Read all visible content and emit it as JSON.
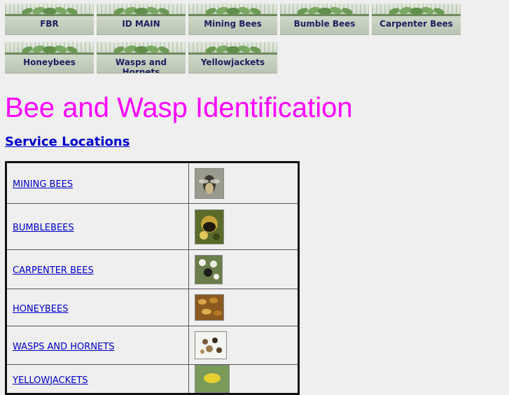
{
  "nav": {
    "row1": [
      "FBR",
      "ID MAIN",
      "Mining Bees",
      "Bumble Bees",
      "Carpenter Bees"
    ],
    "row2": [
      "Honeybees",
      "Wasps and Hornets",
      "Yellowjackets"
    ]
  },
  "page": {
    "title": "Bee and Wasp Identification",
    "service_link": "Service Locations"
  },
  "table": {
    "rows": [
      {
        "label": "MINING BEES",
        "icon": "mining-bee-photo"
      },
      {
        "label": "BUMBLEBEES",
        "icon": "bumblebee-photo"
      },
      {
        "label": "CARPENTER BEES",
        "icon": "carpenter-bee-photo"
      },
      {
        "label": "HONEYBEES",
        "icon": "honeybee-photo"
      },
      {
        "label": "WASPS AND HORNETS",
        "icon": "wasp-nest-photo"
      },
      {
        "label": "YELLOWJACKETS",
        "icon": "yellowjacket-photo"
      }
    ]
  },
  "colors": {
    "title": "#ff00ff",
    "link": "#0000cc",
    "background": "#efefef"
  }
}
